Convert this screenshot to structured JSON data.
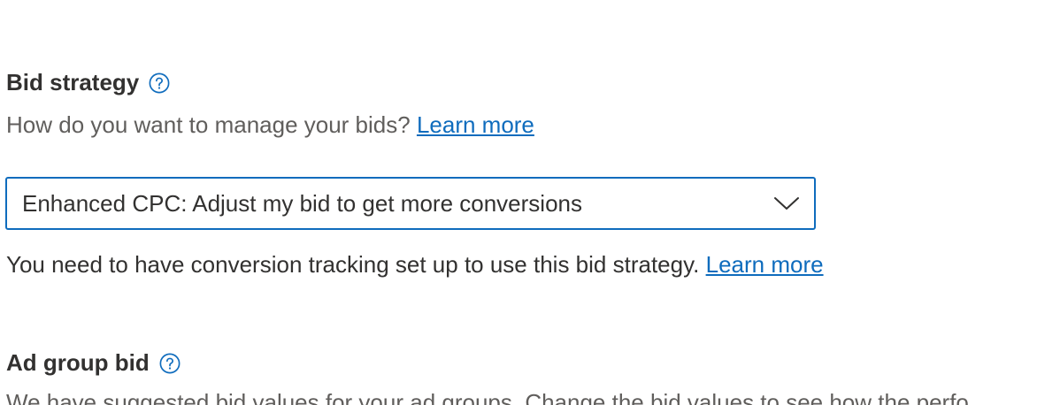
{
  "bid_strategy": {
    "heading": "Bid strategy",
    "help_icon": "question-circle-icon",
    "description": "How do you want to manage your bids? ",
    "learn_more": "Learn more",
    "dropdown": {
      "selected": "Enhanced CPC: Adjust my bid to get more conversions",
      "chevron_icon": "chevron-down-icon"
    },
    "note": "You need to have conversion tracking set up to use this bid strategy. ",
    "note_learn_more": "Learn more"
  },
  "ad_group_bid": {
    "heading": "Ad group bid",
    "help_icon": "question-circle-icon",
    "description": "We have suggested bid values for your ad groups. Change the bid values to see how the perfo"
  },
  "colors": {
    "accent": "#0f6cbd",
    "text": "#323130",
    "secondary_text": "#605e5c"
  }
}
